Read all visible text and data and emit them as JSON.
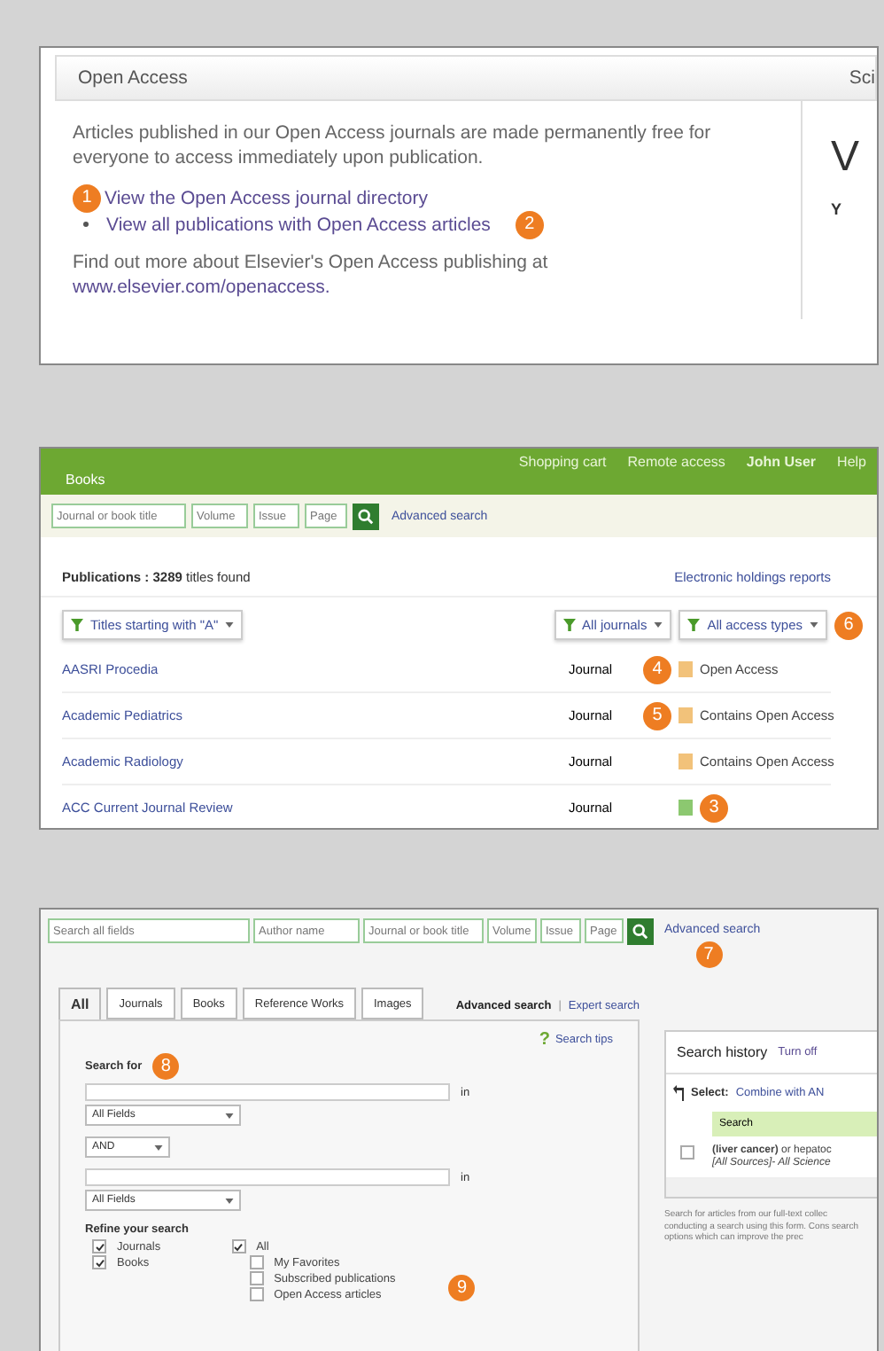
{
  "open_access": {
    "title": "Open Access",
    "side_tab": "Sci",
    "side_letters": [
      "V",
      "Y"
    ],
    "intro": "Articles published in our Open Access journals are made permanently free for everyone to access immediately upon publication.",
    "links": [
      {
        "kind": "badge",
        "badge": "1",
        "text": "View the Open Access journal directory"
      },
      {
        "kind": "bullet",
        "text": "View all publications with Open Access articles",
        "badge": "2"
      }
    ],
    "more": "Find out more about Elsevier's Open Access publishing at",
    "more_link": "www.elsevier.com/openaccess."
  },
  "publications": {
    "section": "Books",
    "top_links": [
      "Shopping cart",
      "Remote access",
      "John User",
      "Help"
    ],
    "search_fields": [
      {
        "placeholder": "Journal or book title"
      },
      {
        "placeholder": "Volume"
      },
      {
        "placeholder": "Issue"
      },
      {
        "placeholder": "Page"
      }
    ],
    "advanced": "Advanced search",
    "count": "**Publications : 3289** titles found",
    "holdings": "Electronic holdings reports",
    "filters": [
      {
        "label": "Titles starting with \"A\""
      },
      {
        "label": "All journals"
      },
      {
        "label": "All access types",
        "badge": "6"
      }
    ],
    "rows": [
      {
        "title": "AASRI Procedia",
        "type": "Journal",
        "access": "Open Access",
        "color": "#f2c27a",
        "badge": "4"
      },
      {
        "title": "Academic Pediatrics",
        "type": "Journal",
        "access": "Contains Open Access",
        "color": "#f2c27a",
        "badge": "5"
      },
      {
        "title": "Academic Radiology",
        "type": "Journal",
        "access": "Contains Open Access",
        "color": "#f2c27a"
      },
      {
        "title": "ACC Current Journal Review",
        "type": "Journal",
        "color": "#8cc870",
        "badge": "3",
        "badge_after": true
      }
    ]
  },
  "search": {
    "search_fields": [
      {
        "placeholder": "Search all fields"
      },
      {
        "placeholder": "Author name"
      },
      {
        "placeholder": "Journal or book title"
      },
      {
        "placeholder": "Volume"
      },
      {
        "placeholder": "Issue"
      },
      {
        "placeholder": "Page"
      }
    ],
    "advanced": "Advanced search",
    "badge": "7",
    "tabs": [
      {
        "label": "All",
        "selected": true
      },
      {
        "label": "Journals",
        "selected": false
      },
      {
        "label": "Books",
        "selected": false
      },
      {
        "label": "Reference Works",
        "selected": false
      },
      {
        "label": "Images",
        "selected": false
      }
    ],
    "modes": [
      "Advanced search",
      "|",
      "Expert search"
    ],
    "tips_icon": "?",
    "tips": "Search tips",
    "search_for": "Search for",
    "search_badge": "8",
    "in_labels": [
      "in",
      "in"
    ],
    "field_select_1": "All Fields",
    "operator": "AND",
    "field_select_2": "All Fields",
    "refine": "Refine your search",
    "content_types": [
      {
        "label": "Journals",
        "checked": true
      },
      {
        "label": "Books",
        "checked": true
      }
    ],
    "access": {
      "label": "All",
      "checked": true,
      "children": [
        {
          "label": "My Favorites",
          "checked": false
        },
        {
          "label": "Subscribed publications",
          "checked": false
        },
        {
          "label": "Open Access articles",
          "checked": false
        }
      ]
    },
    "refine_badge": "9",
    "history": {
      "title": "Search history",
      "toggle": "Turn off",
      "select_label": "Select:",
      "combine": "Combine with AN",
      "column": "Search",
      "query": "**(liver cancer)** or hepatoc",
      "sources": "*[All Sources]- All Science*",
      "checked": false
    },
    "help": "Search for articles from our full-text collec conducting a search using this form. Cons search options which can improve the prec"
  }
}
